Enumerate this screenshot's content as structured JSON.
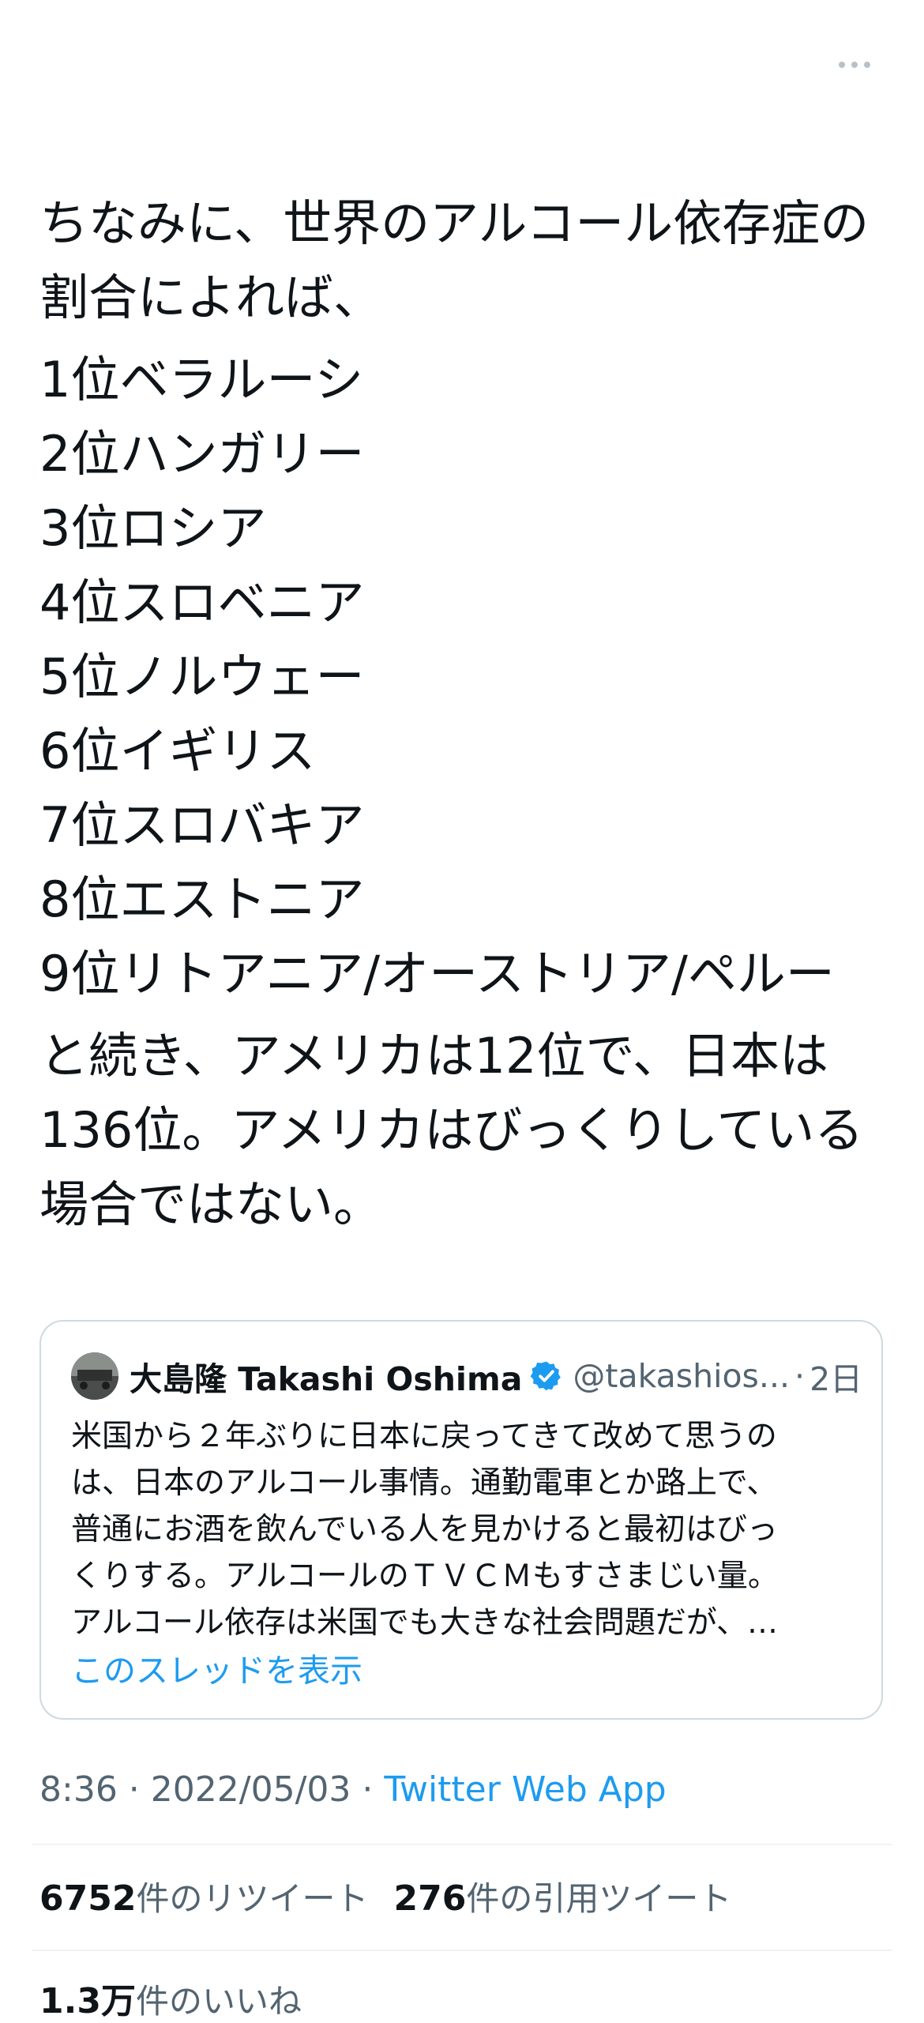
{
  "tweet": {
    "more_icon": "more-horizontal-icon",
    "intro": [
      "ちなみに、世界のアルコール依存症の",
      "割合によれば、"
    ],
    "ranks": [
      "1位ベラルーシ",
      "2位ハンガリー",
      "3位ロシア",
      "4位スロベニア",
      "5位ノルウェー",
      "6位イギリス",
      "7位スロバキア",
      "8位エストニア",
      "9位リトアニア/オーストリア/ペルー"
    ],
    "outro": [
      "と続き、アメリカは12位で、日本は",
      "136位。アメリカはびっくりしている",
      "場合ではない。"
    ]
  },
  "quote": {
    "name": "大島隆 Takashi Oshima",
    "handle": "@takashios...",
    "separator": "·",
    "time": "2日",
    "verified_icon": "verified-badge-icon",
    "body": [
      "米国から２年ぶりに日本に戻ってきて改めて思うの",
      "は、日本のアルコール事情。通勤電車とか路上で、",
      "普通にお酒を飲んでいる人を見かけると最初はびっ",
      "くりする。アルコールのＴＶＣＭもすさまじい量。",
      "アルコール依存は米国でも大きな社会問題だが、…"
    ],
    "thread_link": "このスレッドを表示"
  },
  "meta": {
    "time": "8:36",
    "sep1": " · ",
    "date": "2022/05/03",
    "sep2": " · ",
    "app": "Twitter Web App"
  },
  "stats": {
    "retweets_count": "6752",
    "retweets_label": "件のリツイート",
    "quotes_count": "276",
    "quotes_label": "件の引用ツイート",
    "likes_count": "1.3万",
    "likes_label": "件のいいね"
  },
  "colors": {
    "text": "#0f1419",
    "secondary": "#536471",
    "link": "#1d9bf0",
    "border": "#cfd9de"
  }
}
